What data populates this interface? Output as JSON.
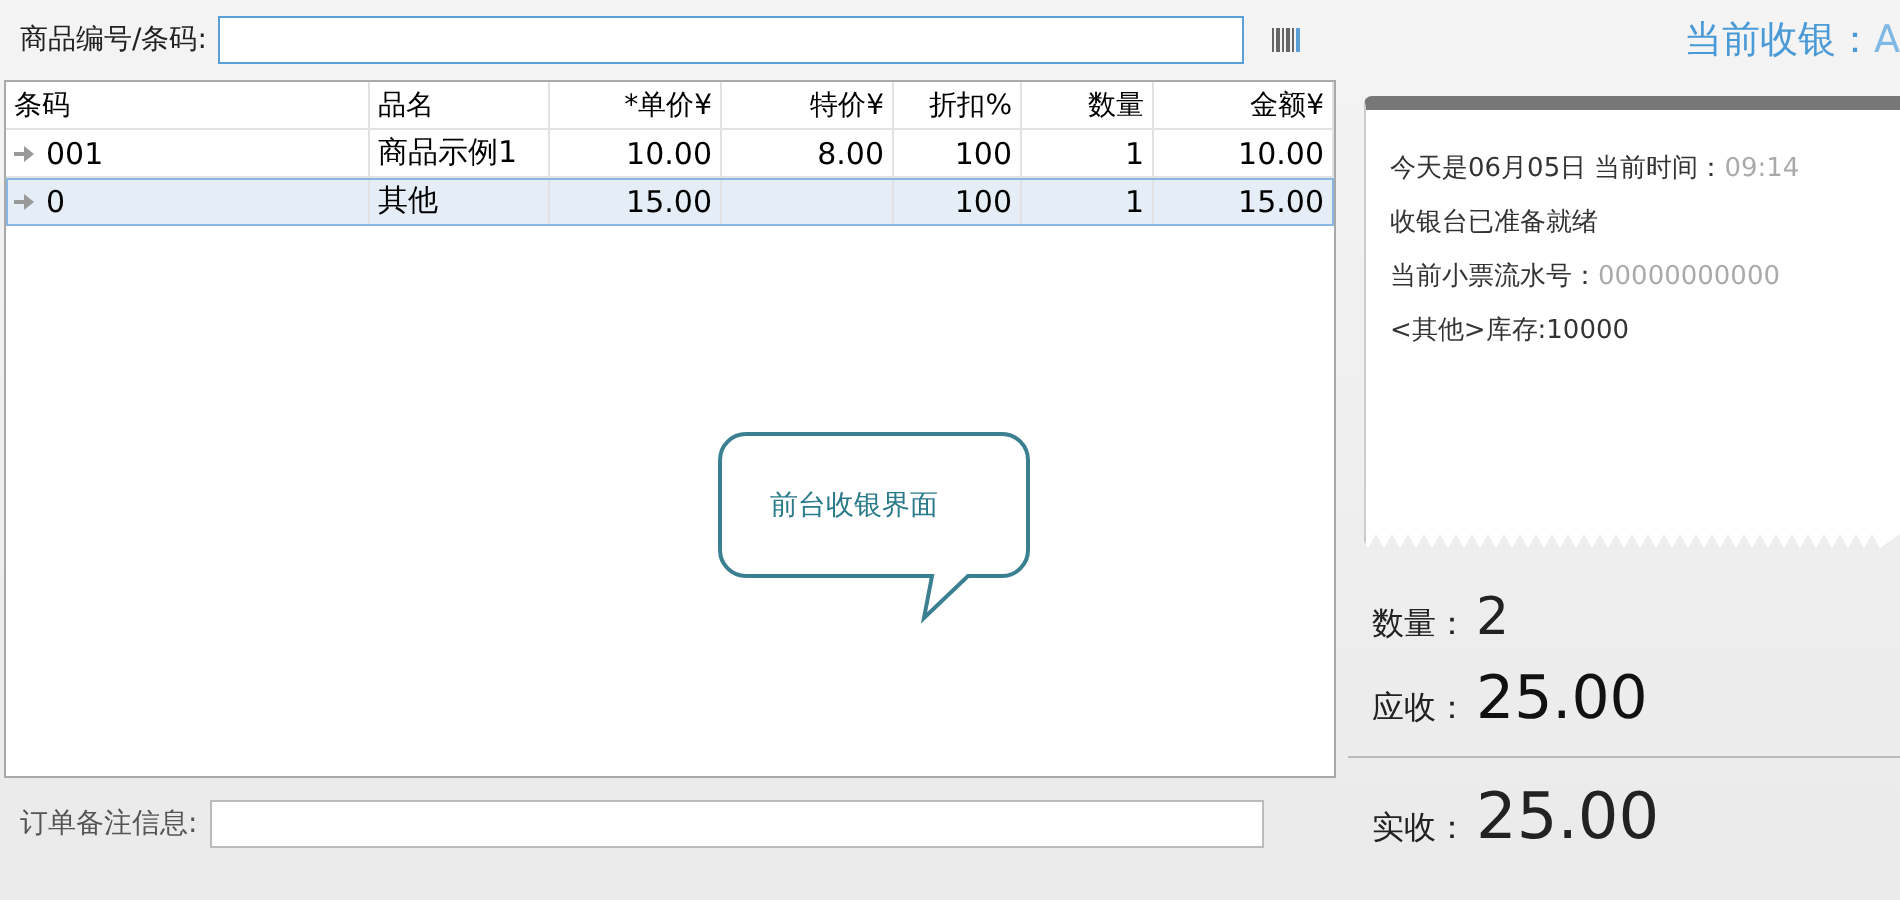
{
  "search": {
    "label": "商品编号/条码:"
  },
  "table": {
    "columns": [
      "条码",
      "品名",
      "*单价¥",
      "特价¥",
      "折扣%",
      "数量",
      "金额¥"
    ],
    "rows": [
      {
        "selected": false,
        "cells": [
          "001",
          "商品示例1",
          "10.00",
          "8.00",
          "100",
          "1",
          "10.00"
        ]
      },
      {
        "selected": true,
        "cells": [
          "0",
          "其他",
          "15.00",
          "",
          "100",
          "1",
          "15.00"
        ]
      }
    ]
  },
  "callout": {
    "text": "前台收银界面"
  },
  "note": {
    "label": "订单备注信息:"
  },
  "cashier": {
    "label": "当前收银：",
    "value": "A"
  },
  "receipt": {
    "lines": [
      {
        "text": "今天是06月05日 当前时间：",
        "value": "09:14"
      },
      {
        "text": "收银台已准备就绪"
      },
      {
        "text": "当前小票流水号：",
        "value": "00000000000"
      },
      {
        "text": "<其他>库存:10000"
      }
    ]
  },
  "summary": {
    "quantity": {
      "label": "数量：",
      "value": "2"
    },
    "due": {
      "label": "应收：",
      "value": "25.00"
    },
    "paid": {
      "label": "实收：",
      "value": "25.00"
    }
  }
}
